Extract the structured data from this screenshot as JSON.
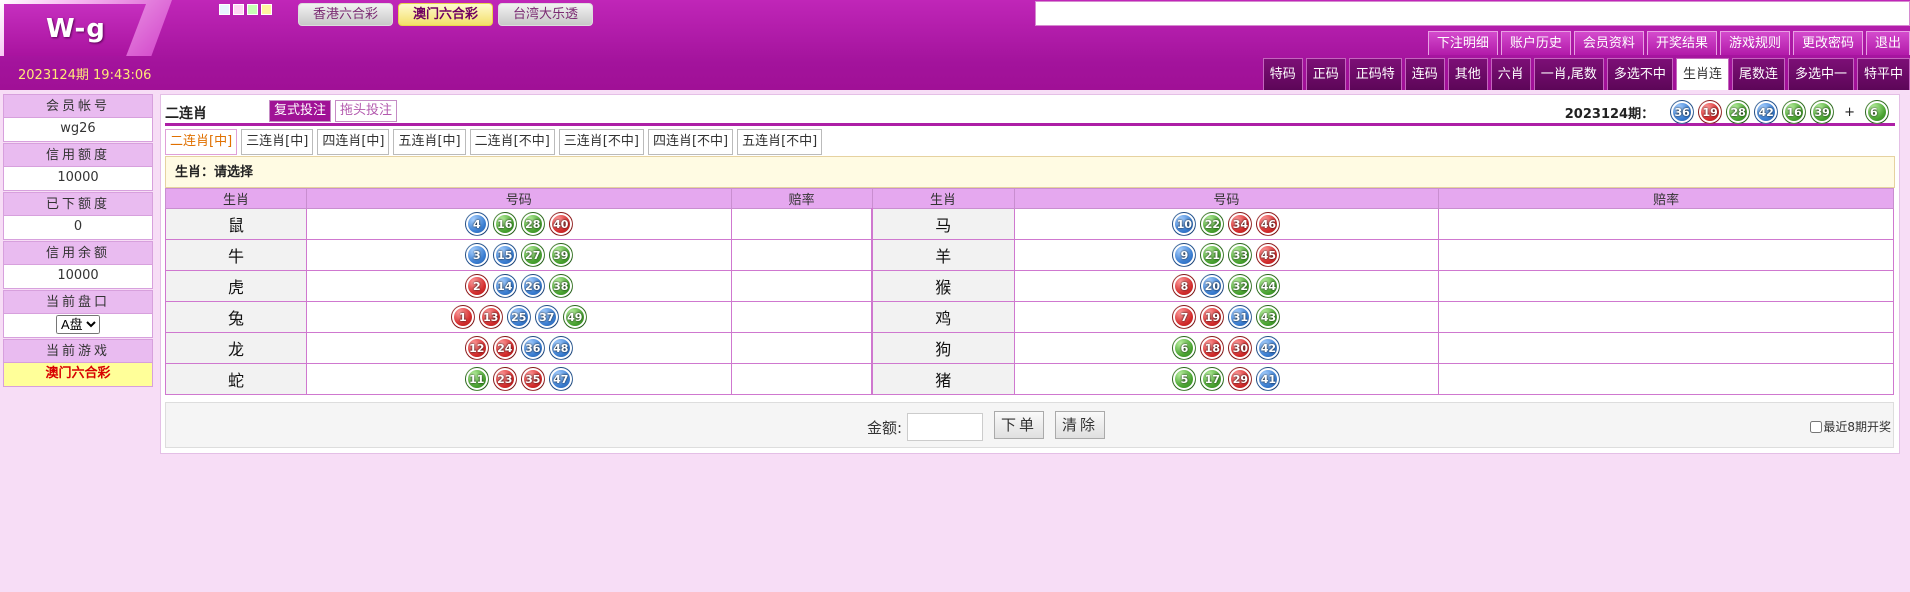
{
  "header": {
    "logo": "W-g",
    "datetime": "2023124期 19:43:06",
    "swatch_colors": [
      "#e8f4ff",
      "#ffd6f4",
      "#c7ffb6",
      "#fff4a0"
    ],
    "lottery_tabs": [
      "香港六合彩",
      "澳门六合彩",
      "台湾大乐透"
    ],
    "active_lottery": 1
  },
  "nav1": [
    "下注明细",
    "账户历史",
    "会员资料",
    "开奖结果",
    "游戏规则",
    "更改密码",
    "退出"
  ],
  "nav2": [
    "特码",
    "正码",
    "正码特",
    "连码",
    "其他",
    "六肖",
    "一肖,尾数",
    "多选不中",
    "生肖连",
    "尾数连",
    "多选中一",
    "特平中"
  ],
  "nav2_active": 8,
  "sidebar": {
    "account_label": "会员帐号",
    "account_value": "wg26",
    "credit_label": "信用额度",
    "credit_value": "10000",
    "used_label": "已下额度",
    "used_value": "0",
    "balance_label": "信用余额",
    "balance_value": "10000",
    "market_label": "当前盘口",
    "market_value": "A盘",
    "game_label": "当前游戏",
    "game_value": "澳门六合彩"
  },
  "main": {
    "title": "二连肖",
    "mode_1": "复式投注",
    "mode_2": "拖头投注",
    "draw_label": "2023124期：",
    "draw_balls": [
      {
        "n": "36",
        "c": "blue"
      },
      {
        "n": "19",
        "c": "red"
      },
      {
        "n": "28",
        "c": "green"
      },
      {
        "n": "42",
        "c": "blue"
      },
      {
        "n": "16",
        "c": "green"
      },
      {
        "n": "39",
        "c": "green"
      }
    ],
    "draw_plus": "+",
    "draw_special": {
      "n": "6",
      "c": "green"
    },
    "subtabs": [
      "二连肖[中]",
      "三连肖[中]",
      "四连肖[中]",
      "五连肖[中]",
      "二连肖[不中]",
      "三连肖[不中]",
      "四连肖[不中]",
      "五连肖[不中]"
    ],
    "active_subtab": 0,
    "selection_text": "生肖：请选择",
    "columns": {
      "zodiac": "生肖",
      "numbers": "号码",
      "odds": "赔率"
    },
    "rows": [
      {
        "left": {
          "z": "鼠",
          "balls": [
            {
              "n": "4",
              "c": "blue"
            },
            {
              "n": "16",
              "c": "green"
            },
            {
              "n": "28",
              "c": "green"
            },
            {
              "n": "40",
              "c": "red"
            }
          ]
        },
        "right": {
          "z": "马",
          "balls": [
            {
              "n": "10",
              "c": "blue"
            },
            {
              "n": "22",
              "c": "green"
            },
            {
              "n": "34",
              "c": "red"
            },
            {
              "n": "46",
              "c": "red"
            }
          ]
        }
      },
      {
        "left": {
          "z": "牛",
          "balls": [
            {
              "n": "3",
              "c": "blue"
            },
            {
              "n": "15",
              "c": "blue"
            },
            {
              "n": "27",
              "c": "green"
            },
            {
              "n": "39",
              "c": "green"
            }
          ]
        },
        "right": {
          "z": "羊",
          "balls": [
            {
              "n": "9",
              "c": "blue"
            },
            {
              "n": "21",
              "c": "green"
            },
            {
              "n": "33",
              "c": "green"
            },
            {
              "n": "45",
              "c": "red"
            }
          ]
        }
      },
      {
        "left": {
          "z": "虎",
          "balls": [
            {
              "n": "2",
              "c": "red"
            },
            {
              "n": "14",
              "c": "blue"
            },
            {
              "n": "26",
              "c": "blue"
            },
            {
              "n": "38",
              "c": "green"
            }
          ]
        },
        "right": {
          "z": "猴",
          "balls": [
            {
              "n": "8",
              "c": "red"
            },
            {
              "n": "20",
              "c": "blue"
            },
            {
              "n": "32",
              "c": "green"
            },
            {
              "n": "44",
              "c": "green"
            }
          ]
        }
      },
      {
        "left": {
          "z": "兔",
          "balls": [
            {
              "n": "1",
              "c": "red"
            },
            {
              "n": "13",
              "c": "red"
            },
            {
              "n": "25",
              "c": "blue"
            },
            {
              "n": "37",
              "c": "blue"
            },
            {
              "n": "49",
              "c": "green"
            }
          ]
        },
        "right": {
          "z": "鸡",
          "balls": [
            {
              "n": "7",
              "c": "red"
            },
            {
              "n": "19",
              "c": "red"
            },
            {
              "n": "31",
              "c": "blue"
            },
            {
              "n": "43",
              "c": "green"
            }
          ]
        }
      },
      {
        "left": {
          "z": "龙",
          "balls": [
            {
              "n": "12",
              "c": "red"
            },
            {
              "n": "24",
              "c": "red"
            },
            {
              "n": "36",
              "c": "blue"
            },
            {
              "n": "48",
              "c": "blue"
            }
          ]
        },
        "right": {
          "z": "狗",
          "balls": [
            {
              "n": "6",
              "c": "green"
            },
            {
              "n": "18",
              "c": "red"
            },
            {
              "n": "30",
              "c": "red"
            },
            {
              "n": "42",
              "c": "blue"
            }
          ]
        }
      },
      {
        "left": {
          "z": "蛇",
          "balls": [
            {
              "n": "11",
              "c": "green"
            },
            {
              "n": "23",
              "c": "red"
            },
            {
              "n": "35",
              "c": "red"
            },
            {
              "n": "47",
              "c": "blue"
            }
          ]
        },
        "right": {
          "z": "猪",
          "balls": [
            {
              "n": "5",
              "c": "green"
            },
            {
              "n": "17",
              "c": "green"
            },
            {
              "n": "29",
              "c": "red"
            },
            {
              "n": "41",
              "c": "blue"
            }
          ]
        }
      }
    ],
    "amount_label": "金额:",
    "submit_label": "下单",
    "clear_label": "清除",
    "recent_label": "最近8期开奖"
  }
}
